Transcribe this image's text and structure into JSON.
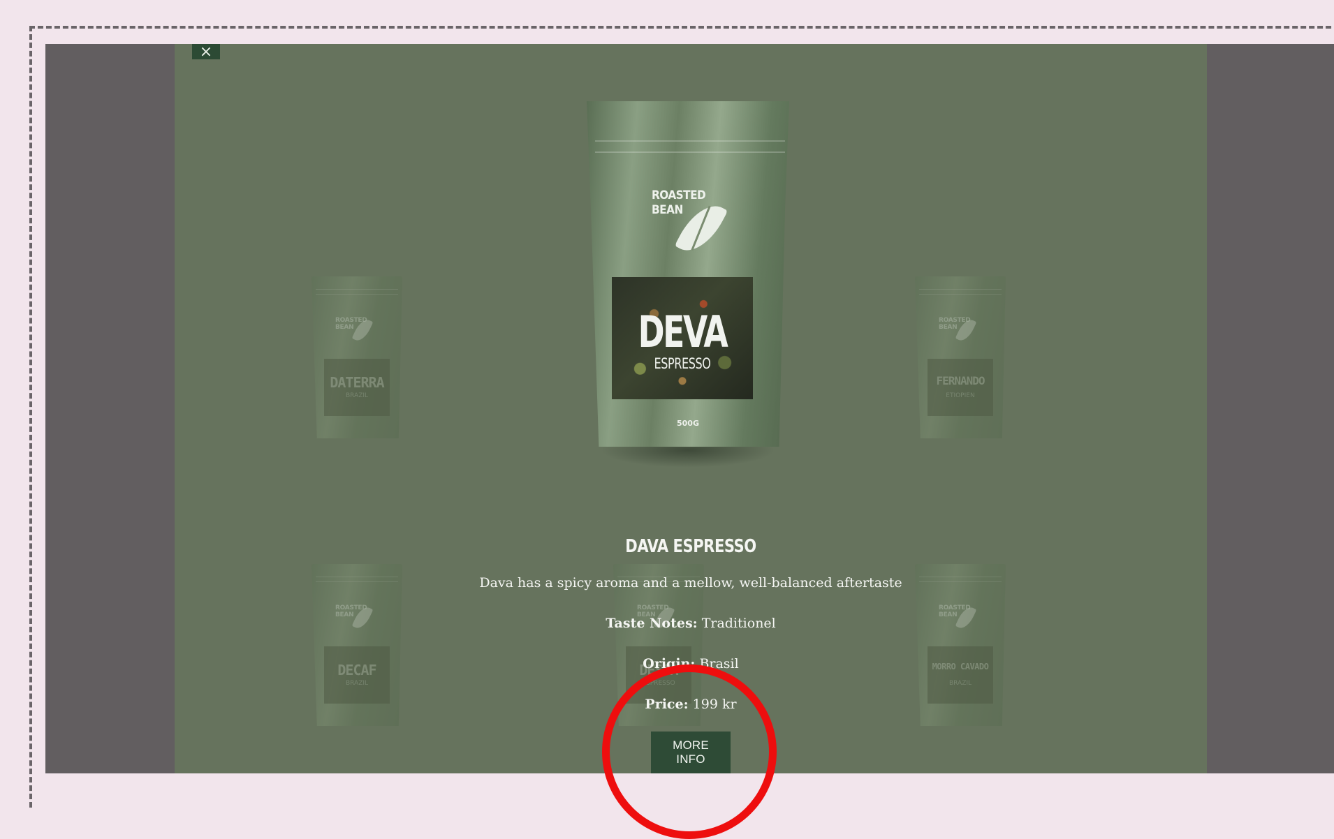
{
  "modal": {
    "close_label": "×",
    "product": {
      "bag": {
        "brand": "ROASTED BEAN",
        "name": "DEVA",
        "type": "ESPRESSO",
        "weight": "500G"
      },
      "title": "DAVA ESPRESSO",
      "description": "Dava has a spicy aroma and a mellow, well-balanced aftertaste",
      "taste_notes_label": "Taste Notes:",
      "taste_notes_value": "Traditionel",
      "origin_label": "Origin:",
      "origin_value": "Brasil",
      "price_label": "Price:",
      "price_value": "199 kr",
      "more_info_label": "MORE INFO"
    }
  },
  "background_products": [
    {
      "brand": "ROASTED BEAN",
      "name": "DATERRA",
      "origin": "BRAZIL"
    },
    {
      "brand": "ROASTED BEAN",
      "name": "FERNANDO",
      "origin": "ETIOPIEN"
    },
    {
      "brand": "ROASTED BEAN",
      "name": "DECAF",
      "origin": "BRAZIL"
    },
    {
      "brand": "ROASTED BEAN",
      "name": "DESTA",
      "origin": "ESPRESSO"
    },
    {
      "brand": "ROASTED BEAN",
      "name": "MORRO CAVADO",
      "origin": "BRAZIL"
    }
  ],
  "colors": {
    "page_bg": "#f2e5ec",
    "overlay_dark": "#625e60",
    "modal_bg": "#66735d",
    "button_bg": "#2e4b36",
    "annotation": "#ee0e0e"
  }
}
